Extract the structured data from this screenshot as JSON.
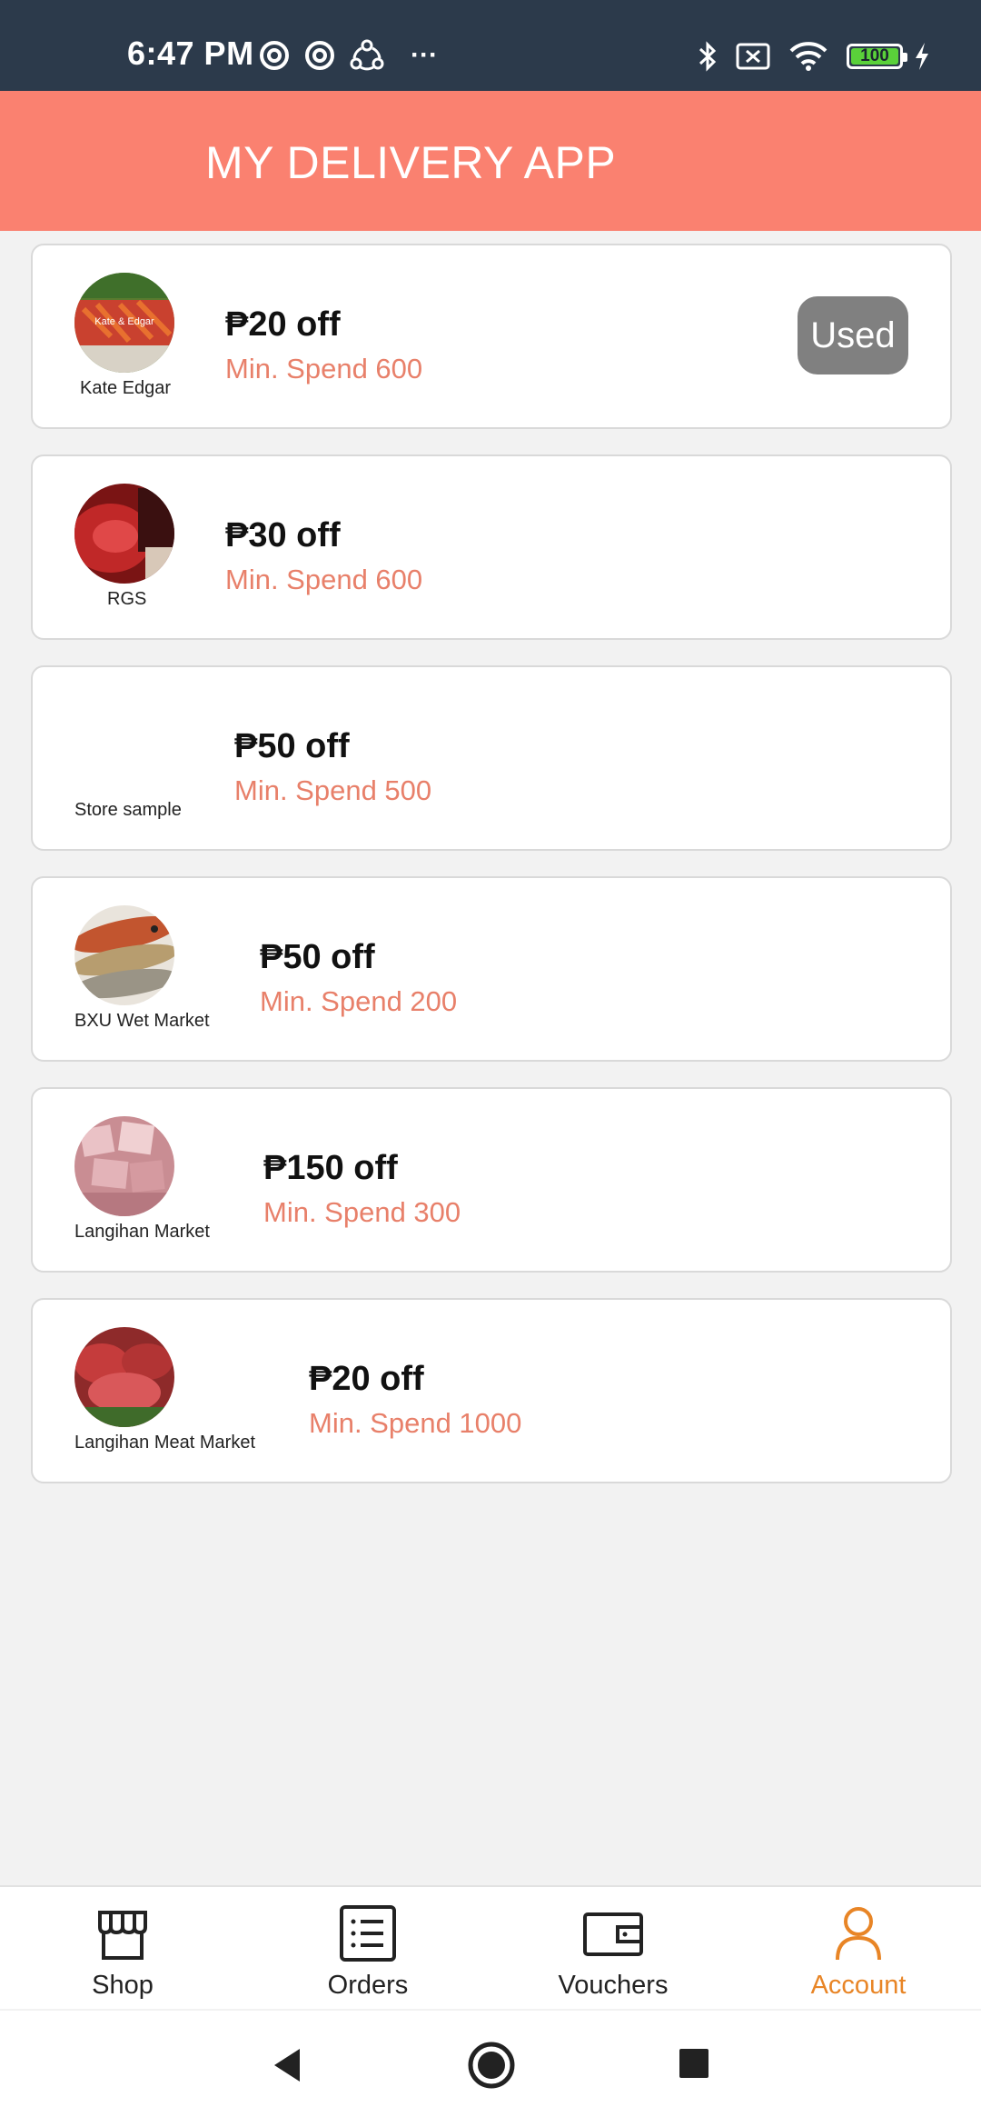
{
  "status_bar": {
    "time": "6:47 PM",
    "more": "···",
    "battery_percent": "100",
    "battery_level": 1.0,
    "icons": [
      "at-sign-icon",
      "at-sign-icon",
      "share-icon",
      "bluetooth-icon",
      "no-sim-icon",
      "wifi-icon",
      "battery-icon",
      "charging-icon"
    ]
  },
  "header": {
    "title": "MY DELIVERY APP"
  },
  "vouchers": [
    {
      "store": "Kate Edgar",
      "discount": "₱20 off",
      "min_spend": "Min. Spend 600",
      "badge": "Used",
      "logo_text": "Kate & Edgar",
      "has_logo": true
    },
    {
      "store": "RGS",
      "discount": "₱30 off",
      "min_spend": "Min. Spend 600",
      "has_logo": true
    },
    {
      "store": "Store sample",
      "discount": "₱50 off",
      "min_spend": "Min. Spend 500",
      "has_logo": false
    },
    {
      "store": "BXU Wet Market",
      "discount": "₱50 off",
      "min_spend": "Min. Spend 200",
      "has_logo": true
    },
    {
      "store": "Langihan Market",
      "discount": "₱150 off",
      "min_spend": "Min. Spend 300",
      "has_logo": true
    },
    {
      "store": "Langihan Meat Market",
      "discount": "₱20 off",
      "min_spend": "Min. Spend 1000",
      "has_logo": true
    }
  ],
  "bottom_nav": [
    {
      "label": "Shop",
      "icon": "shop-icon",
      "active": false
    },
    {
      "label": "Orders",
      "icon": "orders-icon",
      "active": false
    },
    {
      "label": "Vouchers",
      "icon": "wallet-icon",
      "active": false
    },
    {
      "label": "Account",
      "icon": "account-icon",
      "active": true
    }
  ],
  "colors": {
    "header": "#fa8170",
    "min_spend": "#e8806a",
    "active_nav": "#e88526",
    "badge": "#808080",
    "status_bar": "#2c3a4b"
  }
}
